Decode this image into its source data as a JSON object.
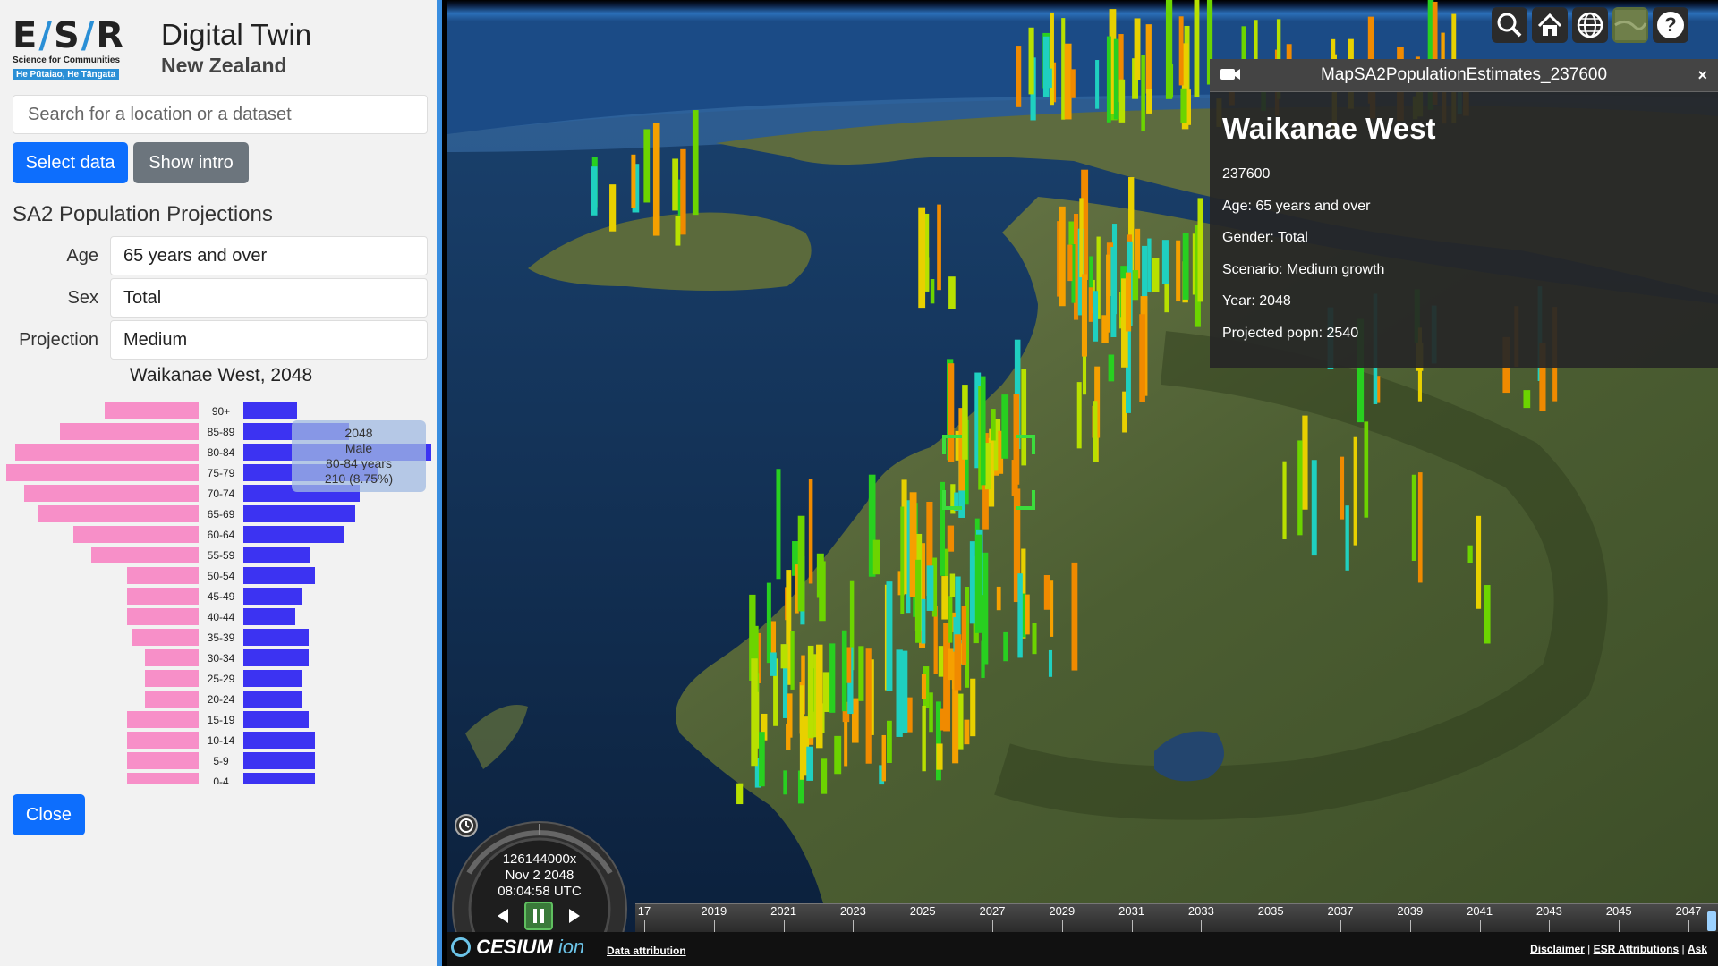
{
  "brand": {
    "mark_left": "E",
    "mark_s": "S",
    "mark_r": "R",
    "sub1": "Science for Communities",
    "sub2": "He Pūtaiao, He Tāngata"
  },
  "app": {
    "title": "Digital Twin",
    "subtitle": "New Zealand"
  },
  "search": {
    "placeholder": "Search for a location or a dataset"
  },
  "buttons": {
    "select_data": "Select data",
    "show_intro": "Show intro",
    "close": "Close"
  },
  "section_title": "SA2 Population Projections",
  "filters": {
    "age_label": "Age",
    "age_value": "65 years and over",
    "sex_label": "Sex",
    "sex_value": "Total",
    "projection_label": "Projection",
    "projection_value": "Medium"
  },
  "chart_data": {
    "type": "bar",
    "title": "Waikanae West, 2048",
    "categories": [
      "90+",
      "85-89",
      "80-84",
      "75-79",
      "70-74",
      "65-69",
      "60-64",
      "55-59",
      "50-54",
      "45-49",
      "40-44",
      "35-39",
      "30-34",
      "25-29",
      "20-24",
      "15-19",
      "10-14",
      "5-9",
      "0-4"
    ],
    "series": [
      {
        "values": [
          105,
          155,
          205,
          215,
          195,
          180,
          140,
          120,
          80,
          80,
          80,
          75,
          60,
          60,
          60,
          80,
          80,
          80,
          80
        ],
        "color": "#f78fc8"
      },
      {
        "values": [
          60,
          118,
          210,
          150,
          130,
          125,
          112,
          75,
          80,
          65,
          58,
          73,
          73,
          65,
          65,
          73,
          80,
          80,
          80
        ],
        "color": "#3c33f2"
      }
    ],
    "colors": {
      "female": "#f78fc8",
      "male": "#3c33f2"
    }
  },
  "tooltip": {
    "year": "2048",
    "sex": "Male",
    "age": "80-84 years",
    "value": "210 (8.75%)"
  },
  "toolbar": {
    "search": "search-icon",
    "home": "home-icon",
    "globe": "globe-icon",
    "basemap": "basemap-icon",
    "help": "help-icon"
  },
  "infobox": {
    "title": "MapSA2PopulationEstimates_237600",
    "close": "×",
    "name": "Waikanae West",
    "id": "237600",
    "age": "Age: 65 years and over",
    "gender": "Gender: Total",
    "scenario": "Scenario: Medium growth",
    "year": "Year: 2048",
    "popn": "Projected popn: 2540"
  },
  "clock": {
    "speed": "126144000x",
    "date": "Nov 2 2048",
    "time": "08:04:58 UTC"
  },
  "timeline": {
    "ticks": [
      "17",
      "2019",
      "2021",
      "2023",
      "2025",
      "2027",
      "2029",
      "2031",
      "2033",
      "2035",
      "2037",
      "2039",
      "2041",
      "2043",
      "2045",
      "2047"
    ]
  },
  "footer": {
    "cesium": "CESIUM",
    "ion": "ion",
    "attribution": "Data attribution",
    "disclaimer": "Disclaimer",
    "esr": "ESR Attributions",
    "ask": "Ask"
  }
}
